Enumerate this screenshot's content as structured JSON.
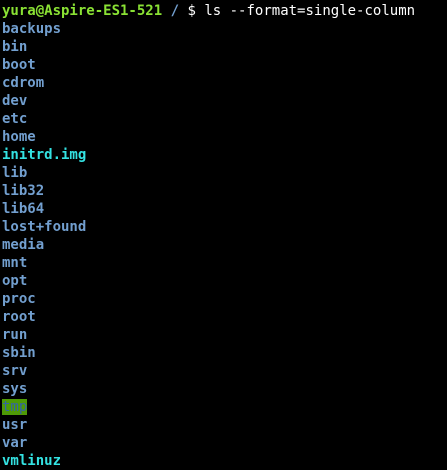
{
  "terminal": {
    "prompt": {
      "user_host": "yura@Aspire-ES1-521",
      "path": "/",
      "symbol": "$",
      "command": "ls --format=single-column"
    },
    "entries": [
      {
        "name": "backups",
        "kind": "dir"
      },
      {
        "name": "bin",
        "kind": "dir"
      },
      {
        "name": "boot",
        "kind": "dir"
      },
      {
        "name": "cdrom",
        "kind": "dir"
      },
      {
        "name": "dev",
        "kind": "dir"
      },
      {
        "name": "etc",
        "kind": "dir"
      },
      {
        "name": "home",
        "kind": "dir"
      },
      {
        "name": "initrd.img",
        "kind": "symlink"
      },
      {
        "name": "lib",
        "kind": "dir"
      },
      {
        "name": "lib32",
        "kind": "dir"
      },
      {
        "name": "lib64",
        "kind": "dir"
      },
      {
        "name": "lost+found",
        "kind": "dir"
      },
      {
        "name": "media",
        "kind": "dir"
      },
      {
        "name": "mnt",
        "kind": "dir"
      },
      {
        "name": "opt",
        "kind": "dir"
      },
      {
        "name": "proc",
        "kind": "dir"
      },
      {
        "name": "root",
        "kind": "dir"
      },
      {
        "name": "run",
        "kind": "dir"
      },
      {
        "name": "sbin",
        "kind": "dir"
      },
      {
        "name": "srv",
        "kind": "dir"
      },
      {
        "name": "sys",
        "kind": "dir"
      },
      {
        "name": "tmp",
        "kind": "sticky-dir"
      },
      {
        "name": "usr",
        "kind": "dir"
      },
      {
        "name": "var",
        "kind": "dir"
      },
      {
        "name": "vmlinuz",
        "kind": "symlink"
      }
    ],
    "colors": {
      "background": "#000000",
      "user_host": "#8ae234",
      "path": "#729fcf",
      "directory": "#729fcf",
      "symlink": "#34e2e2",
      "sticky_fg": "#3465a4",
      "sticky_bg": "#4e9a06",
      "text": "#ffffff"
    }
  }
}
